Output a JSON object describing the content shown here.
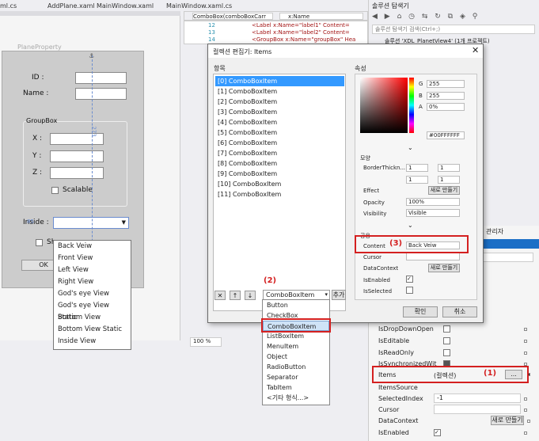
{
  "tabs": [
    "ml.cs",
    "AddPlane.xaml",
    "MainWindow.xaml",
    "MainWindow.xaml.cs"
  ],
  "editor": {
    "element_combo": "ComboBox(comboBoxCarr",
    "name_combo": "x:Name",
    "lines": [
      {
        "num": "12",
        "code": "<Label x:Name=\"label1\" Content="
      },
      {
        "num": "13",
        "code": "<Label x:Name=\"label2\" Content="
      },
      {
        "num": "14",
        "code": "<GroupBox x:Name=\"groupBox\" Hea"
      }
    ]
  },
  "solution": {
    "title": "솔루션 탐색기",
    "search_placeholder": "솔루션 탐색기 검색(Ctrl+;)",
    "root": "솔루션 'XDL_PlanetView4' (1개 프로젝트)"
  },
  "designer": {
    "window_title": "PlaneProperty",
    "labels": {
      "id": "ID :",
      "name": "Name :",
      "group": "GroupBox",
      "x": "X :",
      "y": "Y :",
      "z": "Z :",
      "scalable": "Scalable",
      "inside": "Inside :",
      "show": "Sh",
      "ok": "OK"
    },
    "measure": "273",
    "measure2": "85",
    "zoom": "100 %",
    "dropdown_items": [
      "Back Veiw",
      "Front View",
      "Left View",
      "Right View",
      "God's eye View",
      "God's eye View Static",
      "Bottom View",
      "Bottom View Static",
      "Inside View"
    ]
  },
  "dialog": {
    "title": "컬렉션 편집기: Items",
    "items_header": "항목",
    "props_header": "속성",
    "items": [
      "[0] ComboBoxItem",
      "[1] ComboBoxItem",
      "[2] ComboBoxItem",
      "[3] ComboBoxItem",
      "[4] ComboBoxItem",
      "[5] ComboBoxItem",
      "[6] ComboBoxItem",
      "[7] ComboBoxItem",
      "[8] ComboBoxItem",
      "[9] ComboBoxItem",
      "[10] ComboBoxItem",
      "[11] ComboBoxItem"
    ],
    "type_select": "ComboBoxItem",
    "add_button": "추가",
    "ok": "확인",
    "cancel": "취소",
    "color": {
      "g_label": "G",
      "g": "255",
      "b_label": "B",
      "b": "255",
      "a_label": "A",
      "a": "0%",
      "r": "255",
      "hex": "#00FFFFFF"
    },
    "section_layout": "모양",
    "border_thickness": "BorderThickn...",
    "bt_values": [
      "1",
      "1",
      "1",
      "1"
    ],
    "effect": "Effect",
    "effect_btn": "새로 만들기",
    "opacity": "Opacity",
    "opacity_val": "100%",
    "visibility": "Visibility",
    "visibility_val": "Visible",
    "section_common": "공용",
    "content": "Content",
    "content_val": "Back Veiw",
    "cursor": "Cursor",
    "datacontext": "DataContext",
    "datacontext_btn": "새로 만들기",
    "isenabled": "IsEnabled",
    "isselected": "IsSelected"
  },
  "type_list": [
    "Button",
    "CheckBox",
    "ComboBoxItem",
    "ListBoxItem",
    "MenuItem",
    "Object",
    "RadioButton",
    "Separator",
    "TabItem",
    "<기타 형식...>"
  ],
  "annotations": {
    "one": "(1)",
    "two": "(2)",
    "three": "(3)"
  },
  "props_panel": {
    "header": "관리자",
    "rows": [
      {
        "name": "IsDropDownOpen",
        "type": "check"
      },
      {
        "name": "IsEditable",
        "type": "check"
      },
      {
        "name": "IsReadOnly",
        "type": "check"
      },
      {
        "name": "IsSynchronizedWit",
        "type": "check-filled"
      },
      {
        "name": "Items",
        "value": "(컬렉션)",
        "type": "collection"
      },
      {
        "name": "ItemsSource",
        "type": "none"
      },
      {
        "name": "SelectedIndex",
        "value": "-1",
        "type": "text"
      },
      {
        "name": "Cursor",
        "type": "combo"
      },
      {
        "name": "DataContext",
        "value": "새로 만들기",
        "type": "button"
      },
      {
        "name": "IsEnabled",
        "type": "check-checked"
      }
    ],
    "collection_btn": "..."
  },
  "colors": {
    "accent": "#3399ff",
    "annotation": "#d42020",
    "selection": "#cfe3f7"
  }
}
